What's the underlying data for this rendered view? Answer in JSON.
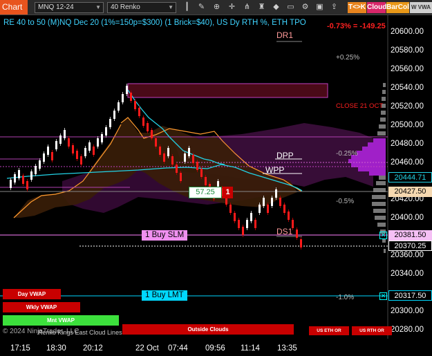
{
  "toolbar": {
    "chart_label": "Chart",
    "instrument": "MNQ 12-24",
    "bar_type": "40 Renko",
    "icons": [
      "bar-style-icon",
      "draw-tools-icon",
      "zoom-icon",
      "crosshair-icon",
      "magnet-icon",
      "indicators-icon",
      "strategies-icon",
      "templates-icon",
      "properties-icon",
      "screenshot-icon",
      "share-icon",
      "dom-icon"
    ],
    "tk_button": "T<>K",
    "cloud_button": "Cloud",
    "barcol_button": "BarCol",
    "w_button": "W VWA"
  },
  "chart": {
    "title": "RE 40 to 50 (M)NQ Dec 20 (1%=150p=$300) (1 Brick=$40), US Dy RTH %, ETH TPO",
    "change_text": "-0.73% = -149.25",
    "copyright": "© 2024 NinjaTrader, LLC",
    "watermark": "Renko Kings East Cloud Lines",
    "colors": {
      "up_brick": "#ffffff",
      "down_brick": "#ff1a1a",
      "cloud_orange": "#ff9a2e",
      "cyan_line": "#22d3e6",
      "profile": "#a020c8",
      "magenta_line": "#e040e0"
    }
  },
  "price_axis": {
    "labels": [
      "20600.00",
      "20580.00",
      "20560.00",
      "20540.00",
      "20520.00",
      "20500.00",
      "20480.00",
      "20460.00",
      "20420.00",
      "20400.00",
      "20360.00",
      "20340.00",
      "20300.00",
      "20280.00"
    ],
    "markers": {
      "cyan_price": "20444.71",
      "orange_price": "20427.50",
      "pink_price": "20381.50",
      "last_price": "20370.25",
      "limit_price": "20317.50"
    }
  },
  "time_axis": {
    "labels": [
      "17:15",
      "18:30",
      "20:12",
      "22 Oct",
      "07:44",
      "09:56",
      "11:14",
      "13:35"
    ]
  },
  "levels": {
    "dr1": "DR1",
    "dpp": "DPP",
    "wpp": "WPP",
    "ds1": "DS1",
    "pct_plus_025": "+0.25%",
    "pct_minus_025": "-0.25%",
    "pct_minus_05": "-0.5%",
    "pct_minus_1": "-1.0%",
    "close_label": "CLOSE 21 OCT"
  },
  "position": {
    "avg_price": "57.25",
    "quantity": "1"
  },
  "orders": {
    "stop": "1 Buy SLM",
    "limit": "1 Buy LMT"
  },
  "buttons": {
    "day_vwap": "Day VWAP",
    "wkly_vwap": "Wkly VWAP",
    "mnt_vwap": "Mnt VWAP",
    "outside_clouds": "Outside Clouds",
    "us_eth_or": "US ETH OR",
    "us_rth_or": "US RTH OR"
  }
}
